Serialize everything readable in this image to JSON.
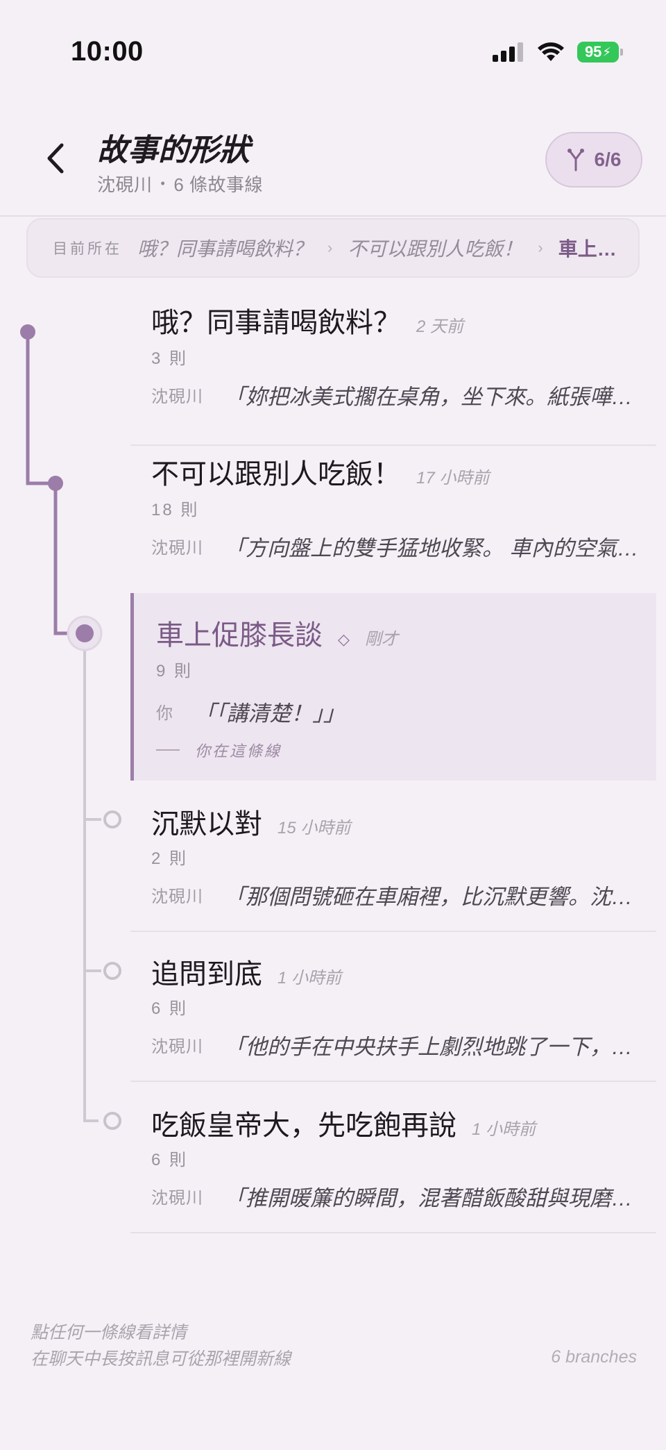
{
  "status_bar": {
    "time": "10:00",
    "battery": "95"
  },
  "header": {
    "title": "故事的形狀",
    "author": "沈硯川",
    "separator": "•",
    "branch_summary": "6 條故事線",
    "branch_counter": "6/6"
  },
  "breadcrumb": {
    "label": "目前所在",
    "items": [
      "哦？同事請喝飲料？",
      "不可以跟別人吃飯！",
      "車上…"
    ],
    "separator": "›"
  },
  "branches": [
    {
      "title": "哦？同事請喝飲料？",
      "time": "2 天前",
      "count": "3 則",
      "author": "沈硯川",
      "preview": "「妳把冰美式擱在桌角，坐下來。紙張嘩啦…",
      "state": "ancestor"
    },
    {
      "title": "不可以跟別人吃飯！",
      "time": "17 小時前",
      "count": "18 則",
      "author": "沈硯川",
      "preview": "「方向盤上的雙手猛地收緊。 車內的空氣像…",
      "state": "ancestor"
    },
    {
      "title": "車上促膝長談",
      "time": "剛才",
      "count": "9 則",
      "author": "你",
      "preview": "「「講清楚！」」",
      "you_here": "你在這條線",
      "state": "current"
    },
    {
      "title": "沉默以對",
      "time": "15 小時前",
      "count": "2 則",
      "author": "沈硯川",
      "preview": "「那個問號砸在車廂裡，比沉默更響。沈硯…",
      "state": "sibling"
    },
    {
      "title": "追問到底",
      "time": "1 小時前",
      "count": "6 則",
      "author": "沈硯川",
      "preview": "「他的手在中央扶手上劇烈地跳了一下，像…",
      "state": "sibling"
    },
    {
      "title": "吃飯皇帝大，先吃飽再說",
      "time": "1 小時前",
      "count": "6 則",
      "author": "沈硯川",
      "preview": "「推開暖簾的瞬間，混著醋飯酸甜與現磨山…",
      "state": "sibling"
    }
  ],
  "footer": {
    "hint_line1": "點任何一條線看詳情",
    "hint_line2": "在聊天中長按訊息可從那裡開新線",
    "count": "6 branches"
  },
  "colors": {
    "accent": "#9c7da9",
    "background": "#f5f0f6",
    "active_bg": "#ede5ef"
  }
}
